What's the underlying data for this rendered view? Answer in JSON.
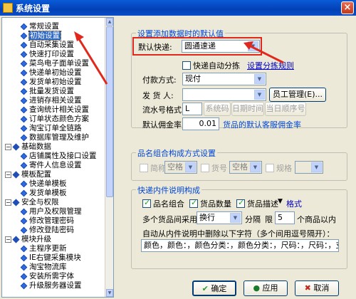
{
  "window": {
    "title": "系统设置",
    "close": "×"
  },
  "tree": {
    "items": [
      {
        "label": "常规设置",
        "level": 2
      },
      {
        "label": "初始设置",
        "level": 2,
        "selected": true
      },
      {
        "label": "自动采集设置",
        "level": 2
      },
      {
        "label": "快速打印设置",
        "level": 2
      },
      {
        "label": "菜鸟电子面单设置",
        "level": 2
      },
      {
        "label": "快递单初始设置",
        "level": 2
      },
      {
        "label": "发货单初始设置",
        "level": 2
      },
      {
        "label": "批量发货设置",
        "level": 2
      },
      {
        "label": "进销存相关设置",
        "level": 2
      },
      {
        "label": "查询统计相关设置",
        "level": 2
      },
      {
        "label": "订单状态颜色方案",
        "level": 2
      },
      {
        "label": "淘宝订单全链路",
        "level": 2
      },
      {
        "label": "数据库管理及维护",
        "level": 2
      },
      {
        "label": "基础数据",
        "level": 1
      },
      {
        "label": "店铺属性及接口设置",
        "level": 2
      },
      {
        "label": "寄件人信息设置",
        "level": 2
      },
      {
        "label": "模板配置",
        "level": 1
      },
      {
        "label": "快递单模板",
        "level": 2
      },
      {
        "label": "发货单模板",
        "level": 2
      },
      {
        "label": "安全与权限",
        "level": 1
      },
      {
        "label": "用户及权限管理",
        "level": 2
      },
      {
        "label": "修改管理密码",
        "level": 2
      },
      {
        "label": "修改登陆密码",
        "level": 2
      },
      {
        "label": "模块升级",
        "level": 1
      },
      {
        "label": "主程序更新",
        "level": 2
      },
      {
        "label": "IE右键采集模块",
        "level": 2
      },
      {
        "label": "淘宝物流库",
        "level": 2
      },
      {
        "label": "安装所需字体",
        "level": 2
      },
      {
        "label": "升级服务器设置",
        "level": 2
      }
    ]
  },
  "defaults_group": {
    "title": "设置添加数据时的默认值",
    "default_express_label": "默认快递:",
    "default_express_value": "圆通速递",
    "auto_split_label": "快递自动分拣",
    "auto_split_checked": false,
    "split_rule_link": "设置分拣规则",
    "payment_label": "付款方式:",
    "payment_value": "现付",
    "shipper_label": "发 货 人:",
    "shipper_value": "",
    "staff_button": "员工管理(E)...",
    "serial_label": "流水号格式:",
    "serial_value": "L",
    "serial_buttons": [
      "系统码",
      "日期时间",
      "当日顺序号"
    ],
    "price_label": "默认佣金率:",
    "price_value": "0.01",
    "price_note": "货品的默认客服佣金率"
  },
  "name_group": {
    "title": "品名组合构成方式设置",
    "items": [
      {
        "label": "简称",
        "select": "空格"
      },
      {
        "label": "货号",
        "select": "空格"
      },
      {
        "label": "规格",
        "select": ""
      }
    ]
  },
  "desc_group": {
    "title": "快递内件说明构成",
    "checks": [
      {
        "label": "品名组合",
        "checked": true
      },
      {
        "label": "货品数量",
        "checked": true
      },
      {
        "label": "货品描述",
        "checked": true
      }
    ],
    "format_label": "格式",
    "multi_label": "多个货品间采用",
    "multi_select": "换行",
    "split_label": "分隔",
    "limit_label": "限",
    "limit_value": "5",
    "limit_suffix": "个商品以内",
    "remove_label": "自动从内件说明中删除以下字符（多个间用逗号隔开）：",
    "remove_value": "颜色，颜色：，颜色分类：，颜色分类：，尺码：，尺码：，支持用"
  },
  "footer": {
    "ok": "确定",
    "apply": "应用",
    "cancel": "取消"
  },
  "colors": {
    "accent": "#0046d5",
    "highlight": "#e0281c",
    "selection": "#316ac5"
  }
}
